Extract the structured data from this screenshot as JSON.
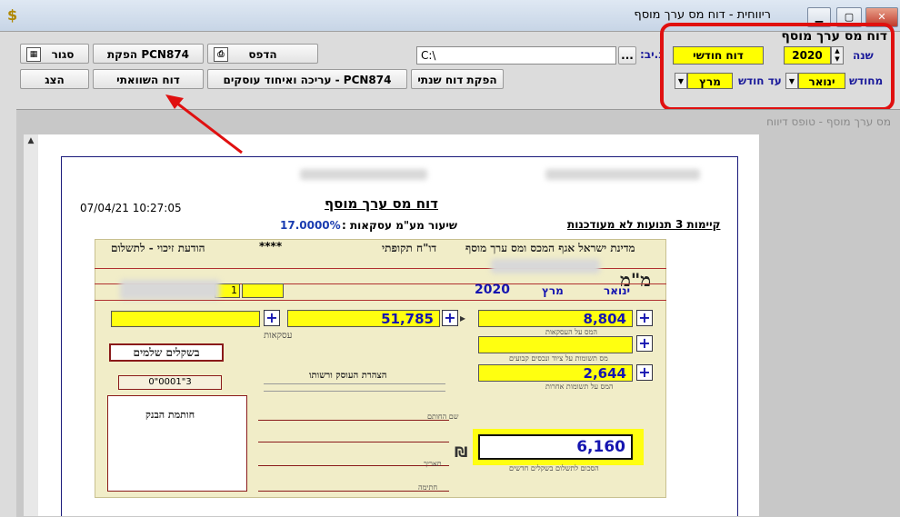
{
  "window": {
    "title": "ריווחית - דוח מס ערך מוסף"
  },
  "toolbar": {
    "close_label": "סגור",
    "produce_pcn_label": "הפקת PCN874",
    "print_label": "הדפס",
    "show_label": "הצג",
    "comparative_label": "דוח השוואתי",
    "edit_merge_label": "עריכה ואיחוד עוסקים - PCN874",
    "annual_label": "הפקת דוח שנתי",
    "path_value": "C:\\",
    "browse_label": "...",
    "dir_label": "נ.יב:"
  },
  "options": {
    "heading": "דוח מס ערך מוסף",
    "report_type": "דוח חודשי",
    "year_label": "שנה",
    "year_value": "2020",
    "from_month_label": "מחודש",
    "from_month_value": "ינואר",
    "to_month_label": "עד חודש",
    "to_month_value": "מרץ"
  },
  "panel": {
    "caption": "מס ערך מוסף - טופס דיווח"
  },
  "report": {
    "title": "דוח מס ערך מוסף",
    "datetime": "07/04/21 10:27:05",
    "rate_label": "שיעור מע\"מ עסקאות :",
    "rate_value": "17.0000%",
    "unsynced_note": "קיימות 3 תנועות לא מעודכנות"
  },
  "form": {
    "header_right": "מדינת ישראל אגף המכס ומס ערך מוסף",
    "header_mid": "דו\"ח תקופתי",
    "header_left": "הודעת זיכוי - לתשלום",
    "stars": "****",
    "logo": "מ\"מ",
    "month_from": "ינואר",
    "month_to": "מרץ",
    "year": "2020",
    "field_mark": "1",
    "sales_taxable": "51,785",
    "vat_on_sales": "8,804",
    "vat_inputs_other": "2,644",
    "total_payment": "6,160",
    "payments_in_shekels": "בשקלים שלמים",
    "ref_number": "0\"0001\"3",
    "bank_stamp": "חותמת הבנק",
    "declaration_title": "הצהרת העוסק ורשותו",
    "sales_label": "עסקאות",
    "vat_sales_label": "המס על העסקאות",
    "inputs_equipment_label": "מס תשומות על ציוד ונכסים קבועים",
    "inputs_other_label": "המס על תשומות אחרות",
    "total_label": "הסכום לתשלום בשקלים חדשים",
    "sign_label": "חתימה",
    "date_label": "תאריך",
    "name_label": "שם החותם"
  }
}
